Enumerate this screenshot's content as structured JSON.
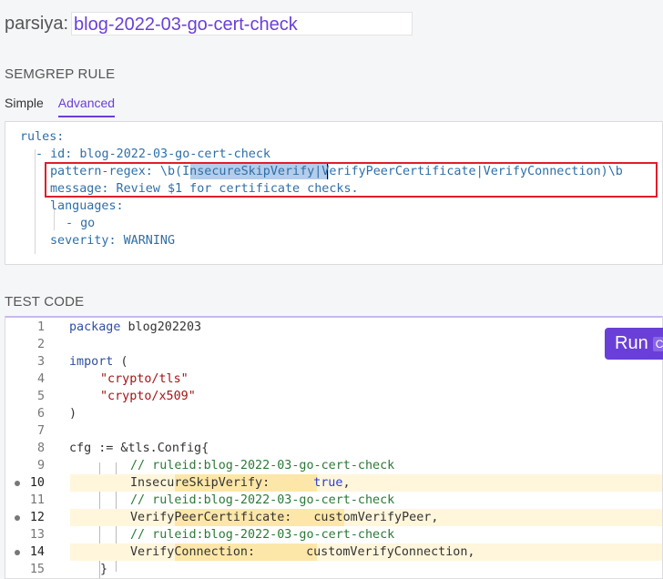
{
  "header": {
    "owner": "parsiya:",
    "rule_name": "blog-2022-03-go-cert-check"
  },
  "rule_section": {
    "title": "SEMGREP RULE",
    "tabs": [
      {
        "label": "Simple"
      },
      {
        "label": "Advanced",
        "active": true
      }
    ],
    "yaml": {
      "l1": "rules:",
      "l2_dash": "- ",
      "l2_key": "id:",
      "l2_val": " blog-2022-03-go-cert-check",
      "l3_key": "pattern-regex:",
      "l3_pre": " \\b(",
      "l3_sel": "InsecureSkipVerify",
      "l3_post": "|VerifyPeerCertificate|VerifyConnection)\\b",
      "l4_key": "message:",
      "l4_val": " Review $1 for certificate checks.",
      "l5_key": "languages:",
      "l6": "- go",
      "l7_key": "severity:",
      "l7_val": " WARNING"
    }
  },
  "test_section": {
    "title": "TEST CODE",
    "run_label": "Run",
    "run_shortcut": "Ctrl",
    "lines": [
      "1",
      "2",
      "3",
      "4",
      "5",
      "6",
      "7",
      "8",
      "9",
      "10",
      "11",
      "12",
      "13",
      "14",
      "15"
    ],
    "code": {
      "l1a": "package",
      "l1b": " blog202203",
      "l3a": "import",
      "l3b": " (",
      "l4": "\"crypto/tls\"",
      "l5": "\"crypto/x509\"",
      "l6": ")",
      "l8": "cfg := &tls.Config{",
      "l9": "// ruleid:blog-2022-03-go-cert-check",
      "l10a": "InsecureSkipVerify:",
      "l10b": "true",
      "l10c": ",",
      "l11": "// ruleid:blog-2022-03-go-cert-check",
      "l12a": "VerifyPeerCertificate:",
      "l12b": "customVerifyPeer,",
      "l13": "// ruleid:blog-2022-03-go-cert-check",
      "l14a": "VerifyConnection:",
      "l14b": "customVerifyConnection,",
      "l15": "}"
    },
    "match_lines": [
      "10",
      "12",
      "14"
    ]
  },
  "colors": {
    "accent": "#6a3fd8",
    "match_highlight": "#fde7a8",
    "red_box": "#e01e2a"
  }
}
